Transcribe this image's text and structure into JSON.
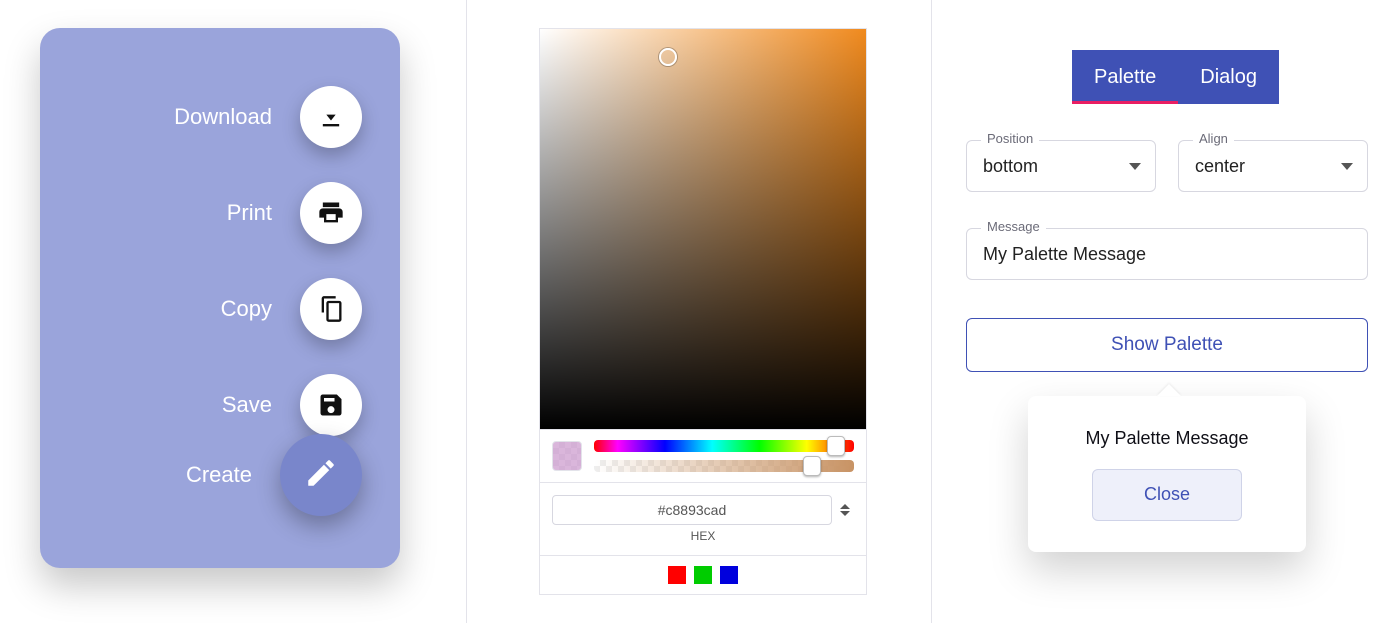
{
  "speed_dial": {
    "actions": [
      {
        "label": "Download"
      },
      {
        "label": "Print"
      },
      {
        "label": "Copy"
      },
      {
        "label": "Save"
      }
    ],
    "main_label": "Create"
  },
  "color_picker": {
    "hex_value": "#c8893cad",
    "format_label": "HEX"
  },
  "panel": {
    "tabs": {
      "palette": "Palette",
      "dialog": "Dialog"
    },
    "position": {
      "label": "Position",
      "value": "bottom"
    },
    "align": {
      "label": "Align",
      "value": "center"
    },
    "message": {
      "label": "Message",
      "value": "My Palette Message"
    },
    "show_label": "Show Palette",
    "popover": {
      "message": "My Palette Message",
      "close": "Close"
    }
  }
}
